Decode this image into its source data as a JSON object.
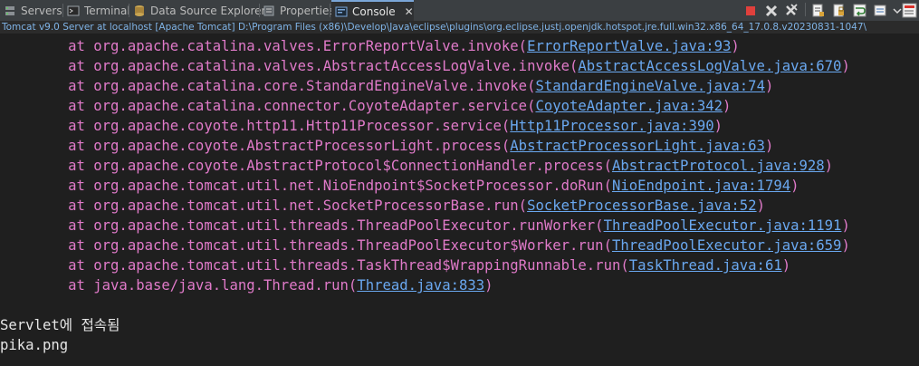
{
  "tabs": [
    {
      "label": "Servers"
    },
    {
      "label": "Terminal"
    },
    {
      "label": "Data Source Explorer"
    },
    {
      "label": "Properties"
    },
    {
      "label": "Console"
    }
  ],
  "status": "Tomcat v9.0 Server at localhost [Apache Tomcat] D:\\Program Files (x86)\\Develop\\Java\\eclipse\\plugins\\org.eclipse.justj.openjdk.hotspot.jre.full.win32.x86_64_17.0.8.v20230831-1047\\",
  "console": {
    "trace": [
      {
        "at": "        at org.apache.catalina.valves.ErrorReportValve.invoke(",
        "link": "ErrorReportValve.java:93",
        "end": ")"
      },
      {
        "at": "        at org.apache.catalina.valves.AbstractAccessLogValve.invoke(",
        "link": "AbstractAccessLogValve.java:670",
        "end": ")"
      },
      {
        "at": "        at org.apache.catalina.core.StandardEngineValve.invoke(",
        "link": "StandardEngineValve.java:74",
        "end": ")"
      },
      {
        "at": "        at org.apache.catalina.connector.CoyoteAdapter.service(",
        "link": "CoyoteAdapter.java:342",
        "end": ")"
      },
      {
        "at": "        at org.apache.coyote.http11.Http11Processor.service(",
        "link": "Http11Processor.java:390",
        "end": ")"
      },
      {
        "at": "        at org.apache.coyote.AbstractProcessorLight.process(",
        "link": "AbstractProcessorLight.java:63",
        "end": ")"
      },
      {
        "at": "        at org.apache.coyote.AbstractProtocol$ConnectionHandler.process(",
        "link": "AbstractProtocol.java:928",
        "end": ")"
      },
      {
        "at": "        at org.apache.tomcat.util.net.NioEndpoint$SocketProcessor.doRun(",
        "link": "NioEndpoint.java:1794",
        "end": ")"
      },
      {
        "at": "        at org.apache.tomcat.util.net.SocketProcessorBase.run(",
        "link": "SocketProcessorBase.java:52",
        "end": ")"
      },
      {
        "at": "        at org.apache.tomcat.util.threads.ThreadPoolExecutor.runWorker(",
        "link": "ThreadPoolExecutor.java:1191",
        "end": ")"
      },
      {
        "at": "        at org.apache.tomcat.util.threads.ThreadPoolExecutor$Worker.run(",
        "link": "ThreadPoolExecutor.java:659",
        "end": ")"
      },
      {
        "at": "        at org.apache.tomcat.util.threads.TaskThread$WrappingRunnable.run(",
        "link": "TaskThread.java:61",
        "end": ")"
      },
      {
        "at": "        at java.base/java.lang.Thread.run(",
        "link": "Thread.java:833",
        "end": ")"
      }
    ],
    "output": [
      "Servlet에 접속됨",
      "pika.png"
    ]
  },
  "colors": {
    "error": "#e07ac9",
    "link": "#6aa8f0",
    "background": "#1f1f1f"
  },
  "icons": [
    "servers-icon",
    "terminal-icon",
    "data-source-icon",
    "properties-icon",
    "console-icon",
    "terminate-icon",
    "remove-launch-icon",
    "remove-all-terminated-icon",
    "clear-console-icon",
    "scroll-lock-icon",
    "word-wrap-icon",
    "pin-console-icon",
    "display-selected-console-icon",
    "open-console-icon"
  ]
}
